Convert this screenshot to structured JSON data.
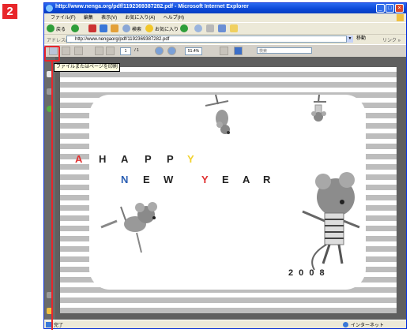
{
  "step_number": "2",
  "window": {
    "title": "http://www.nenga.org/pdf/1192369387282.pdf - Microsoft Internet Explorer",
    "controls": [
      "_",
      "□",
      "×"
    ]
  },
  "menu": [
    "ファイル(F)",
    "編集",
    "表示(V)",
    "お気に入り(A)",
    "ヘルプ(H)"
  ],
  "toolbar": {
    "back_label": "戻る",
    "search_label": "検索",
    "favorites_label": "お気に入り"
  },
  "address": {
    "label": "アドレス(D)",
    "value": "http://www.nengaorg/pdf/1192369387282.pdf",
    "go_label": "移動",
    "links_label": "リンク »"
  },
  "pdf_toolbar": {
    "page_value": "1",
    "page_total": "/ 1",
    "zoom_value": "51.4%",
    "find_placeholder": "検索"
  },
  "tooltip": "ファイルまたはページを印刷",
  "greeting": {
    "line1": [
      "A",
      "H",
      "A",
      "P",
      "P",
      "Y"
    ],
    "line2": [
      "N",
      "E",
      "W",
      "Y",
      "E",
      "A",
      "R"
    ],
    "year": "2 0 0 8"
  },
  "status": {
    "text": "完了",
    "zone": "インターネット"
  },
  "colors": {
    "accent_red": "#e8262a",
    "ie_blue": "#0a46d6",
    "letter_red": "#e03030",
    "letter_yellow": "#f2d22e",
    "letter_blue": "#2b5fb3"
  }
}
